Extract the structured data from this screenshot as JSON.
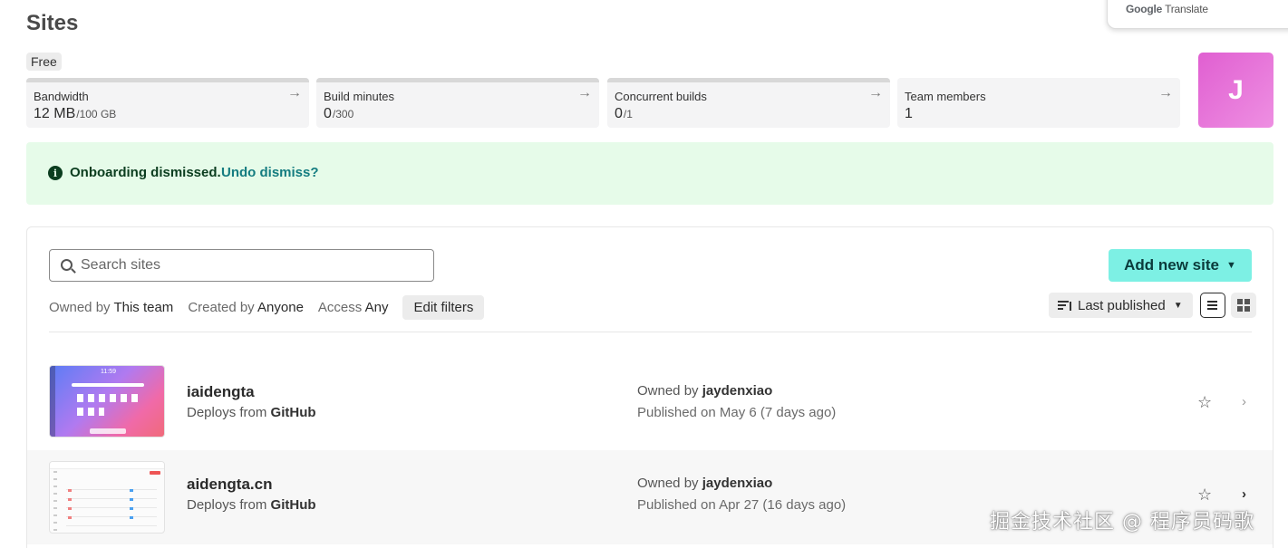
{
  "page": {
    "title": "Sites"
  },
  "translate": {
    "brand": "Google",
    "label": "Translate"
  },
  "plan": {
    "badge": "Free"
  },
  "usage": [
    {
      "label": "Bandwidth",
      "value": "12 MB",
      "limit": "/100 GB"
    },
    {
      "label": "Build minutes",
      "value": "0",
      "limit": "/300"
    },
    {
      "label": "Concurrent builds",
      "value": "0",
      "limit": "/1"
    },
    {
      "label": "Team members",
      "value": "1",
      "limit": ""
    }
  ],
  "avatar": {
    "initial": "J",
    "color": "#e05fd1"
  },
  "notice": {
    "message": "Onboarding dismissed.",
    "link": "Undo dismiss?",
    "bg": "#e6fbe9"
  },
  "search": {
    "placeholder": "Search sites",
    "value": ""
  },
  "add_site": {
    "label": "Add new site",
    "color": "#7df0e4"
  },
  "filters": [
    {
      "key": "Owned by",
      "value": "This team"
    },
    {
      "key": "Created by",
      "value": "Anyone"
    },
    {
      "key": "Access",
      "value": "Any"
    }
  ],
  "edit_filters": {
    "label": "Edit filters"
  },
  "sort": {
    "label": "Last published"
  },
  "sites": [
    {
      "name": "iaidengta",
      "deploy_prefix": "Deploys from",
      "deploy_source": "GitHub",
      "owner_prefix": "Owned by",
      "owner": "jaydenxiao",
      "published": "Published on May 6 (7 days ago)"
    },
    {
      "name": "aidengta.cn",
      "deploy_prefix": "Deploys from",
      "deploy_source": "GitHub",
      "owner_prefix": "Owned by",
      "owner": "jaydenxiao",
      "published": "Published on Apr 27 (16 days ago)"
    }
  ],
  "watermark": {
    "text": "掘金技术社区 @ 程序员码歌"
  }
}
